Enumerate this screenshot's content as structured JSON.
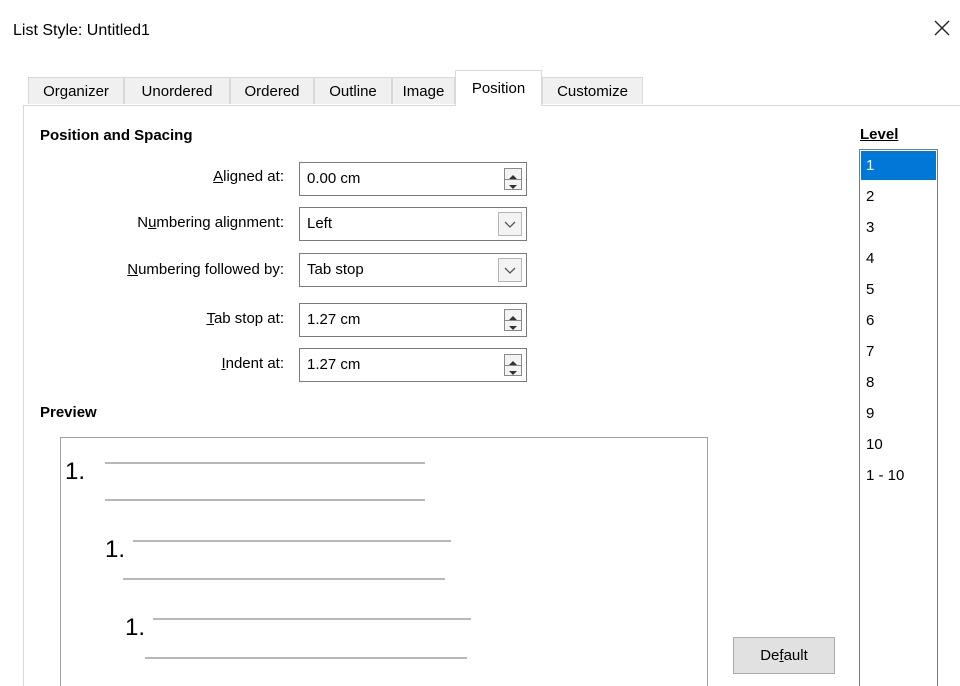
{
  "window": {
    "title": "List Style: Untitled1",
    "close_icon": "close-icon"
  },
  "tabs": [
    {
      "label": "Organizer"
    },
    {
      "label": "Unordered"
    },
    {
      "label": "Ordered"
    },
    {
      "label": "Outline"
    },
    {
      "label": "Image"
    },
    {
      "label": "Position",
      "active": true
    },
    {
      "label": "Customize"
    }
  ],
  "position_spacing": {
    "heading": "Position and Spacing",
    "aligned_at": {
      "label": "Aligned at:",
      "value": "0.00 cm"
    },
    "numbering_alignment": {
      "label": "Numbering alignment:",
      "value": "Left"
    },
    "numbering_followed_by": {
      "label": "Numbering followed by:",
      "value": "Tab stop"
    },
    "tab_stop_at": {
      "label": "Tab stop at:",
      "value": "1.27 cm"
    },
    "indent_at": {
      "label": "Indent at:",
      "value": "1.27 cm"
    }
  },
  "preview": {
    "heading": "Preview",
    "numbers": [
      "1.",
      "1.",
      "1."
    ]
  },
  "level": {
    "heading": "Level",
    "items": [
      "1",
      "2",
      "3",
      "4",
      "5",
      "6",
      "7",
      "8",
      "9",
      "10",
      "1 - 10"
    ],
    "selected": "1"
  },
  "buttons": {
    "default_label": "Default"
  },
  "colors": {
    "selection": "#0078d7",
    "tab_bg": "#f0f0f0"
  }
}
